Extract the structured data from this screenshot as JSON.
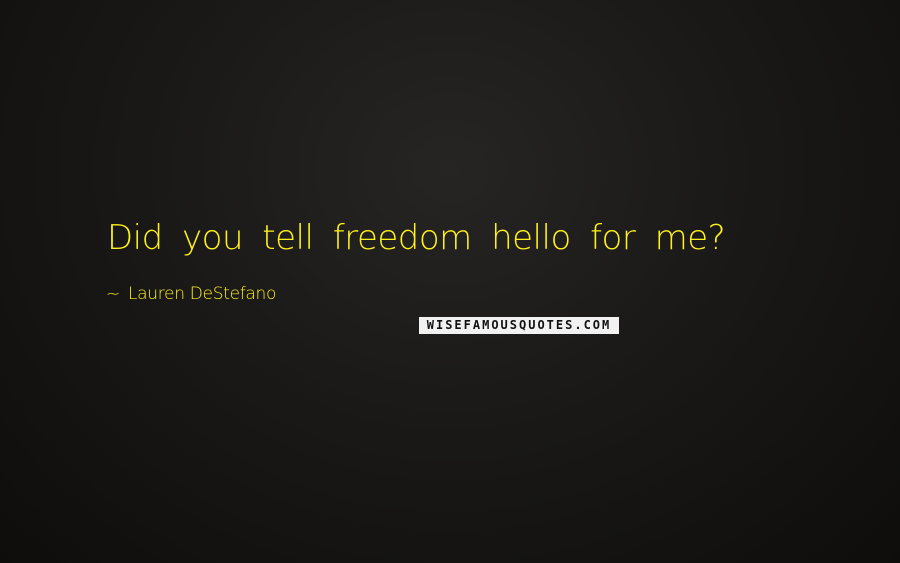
{
  "quote": {
    "text": "Did you tell freedom hello for me?",
    "author_prefix": "~",
    "author": "Lauren DeStefano"
  },
  "watermark": {
    "text": "WISEFAMOUSQUOTES.COM"
  },
  "colors": {
    "text": "#fff21c",
    "background": "#1a1917"
  }
}
